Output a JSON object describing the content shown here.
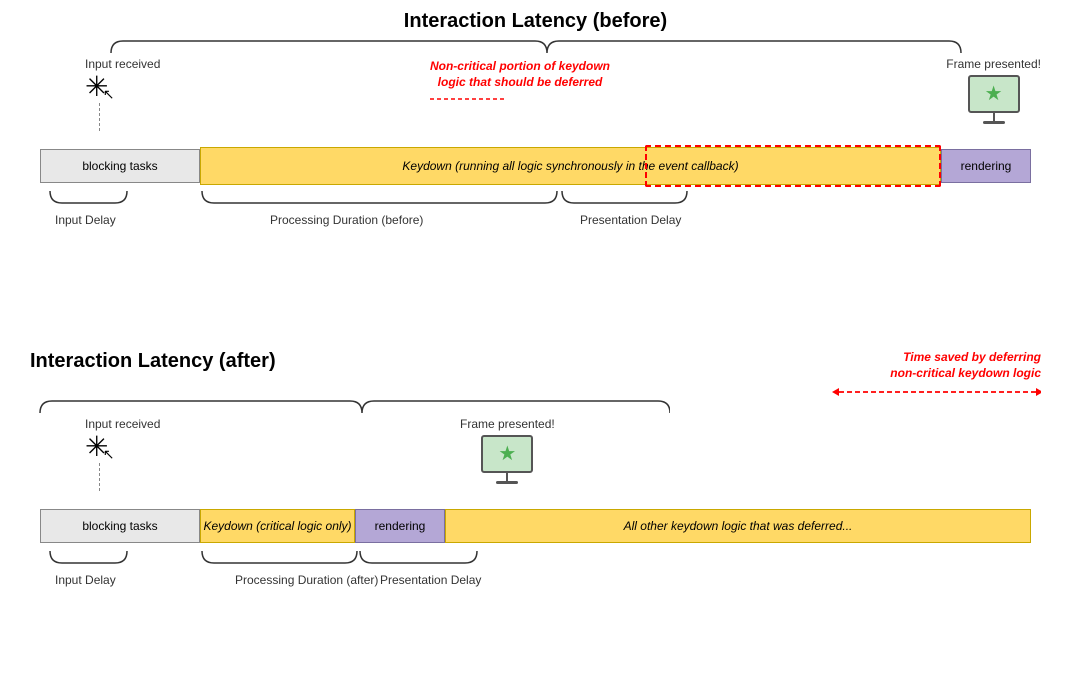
{
  "top": {
    "title": "Interaction Latency (before)",
    "input_label": "Input received",
    "frame_label": "Frame presented!",
    "bar_blocking": "blocking tasks",
    "bar_keydown": "Keydown (running all logic synchronously in the event callback)",
    "bar_rendering": "rendering",
    "red_note_line1": "Non-critical portion of keydown",
    "red_note_line2": "logic that should be deferred",
    "sub_input_delay": "Input Delay",
    "sub_processing": "Processing Duration (before)",
    "sub_presentation": "Presentation Delay"
  },
  "bottom": {
    "title": "Interaction Latency (after)",
    "input_label": "Input received",
    "frame_label": "Frame presented!",
    "bar_blocking": "blocking tasks",
    "bar_keydown": "Keydown (critical logic only)",
    "bar_rendering": "rendering",
    "bar_deferred": "All other keydown logic that was deferred...",
    "time_saved_line1": "Time saved by deferring",
    "time_saved_line2": "non-critical keydown logic",
    "sub_input_delay": "Input Delay",
    "sub_processing": "Processing Duration (after)",
    "sub_presentation": "Presentation Delay"
  }
}
